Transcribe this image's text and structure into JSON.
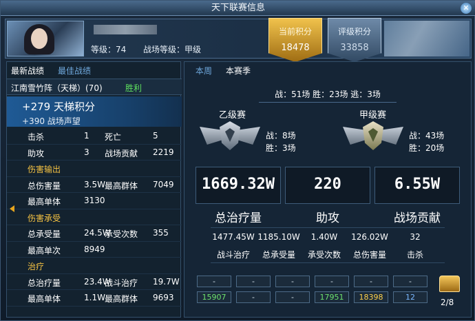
{
  "window": {
    "title": "天下联赛信息",
    "close": "✕"
  },
  "header": {
    "level_label": "等级：74",
    "battle_level_label": "战场等级：甲级",
    "current_score": {
      "label": "当前积分",
      "value": "18478"
    },
    "rank_score": {
      "label": "评级积分",
      "value": "33858"
    }
  },
  "left": {
    "tabs": [
      "最新战绩",
      "最佳战绩"
    ],
    "battle_name": "江南雪竹阵（天梯）(70)",
    "battle_result": "胜利",
    "ladder_points": "+279 天梯积分",
    "battle_reputation": "+390 战场声望",
    "stats": [
      {
        "k1": "击杀",
        "v1": "1",
        "k2": "死亡",
        "v2": "5"
      },
      {
        "k1": "助攻",
        "v1": "3",
        "k2": "战场贡献",
        "v2": "2219"
      },
      {
        "section": "伤害输出"
      },
      {
        "k1": "总伤害量",
        "v1": "3.5W",
        "k2": "最高群体",
        "v2": "7049"
      },
      {
        "k1": "最高单体",
        "v1": "3130",
        "k2": "",
        "v2": ""
      },
      {
        "section": "伤害承受"
      },
      {
        "k1": "总承受量",
        "v1": "24.5W",
        "k2": "承受次数",
        "v2": "355"
      },
      {
        "k1": "最高单次",
        "v1": "8949",
        "k2": "",
        "v2": ""
      },
      {
        "section": "治疗"
      },
      {
        "k1": "总治疗量",
        "v1": "23.4W",
        "k2": "战斗治疗",
        "v2": "19.7W"
      },
      {
        "k1": "最高单体",
        "v1": "1.1W",
        "k2": "最高群体",
        "v2": "9693"
      }
    ]
  },
  "right": {
    "tabs": [
      "本周",
      "本赛季"
    ],
    "summary": "战：51场   胜：23场   逃：3场",
    "division_b": {
      "title": "乙级赛",
      "battles": "战：8场",
      "wins": "胜：3场"
    },
    "division_a": {
      "title": "甲级赛",
      "battles": "战：43场",
      "wins": "胜：20场"
    },
    "big": [
      {
        "value": "1669.32W",
        "label": "总治疗量"
      },
      {
        "value": "220",
        "label": "助攻"
      },
      {
        "value": "6.55W",
        "label": "战场贡献"
      }
    ],
    "detail_values": [
      "1477.45W",
      "1185.10W",
      "1.40W",
      "126.02W",
      "32"
    ],
    "detail_labels": [
      "战斗治疗",
      "总承受量",
      "承受次数",
      "总伤害量",
      "击杀"
    ],
    "slots_top": [
      "-",
      "-",
      "-",
      "-",
      "-",
      "-"
    ],
    "slots_bottom": [
      "15907",
      "-",
      "-",
      "17951",
      "18398",
      "12"
    ],
    "pager": "2/8"
  },
  "colors": {
    "win": "#5ee05e",
    "section": "#f6c343",
    "accent_gold": "#f0c24c"
  }
}
